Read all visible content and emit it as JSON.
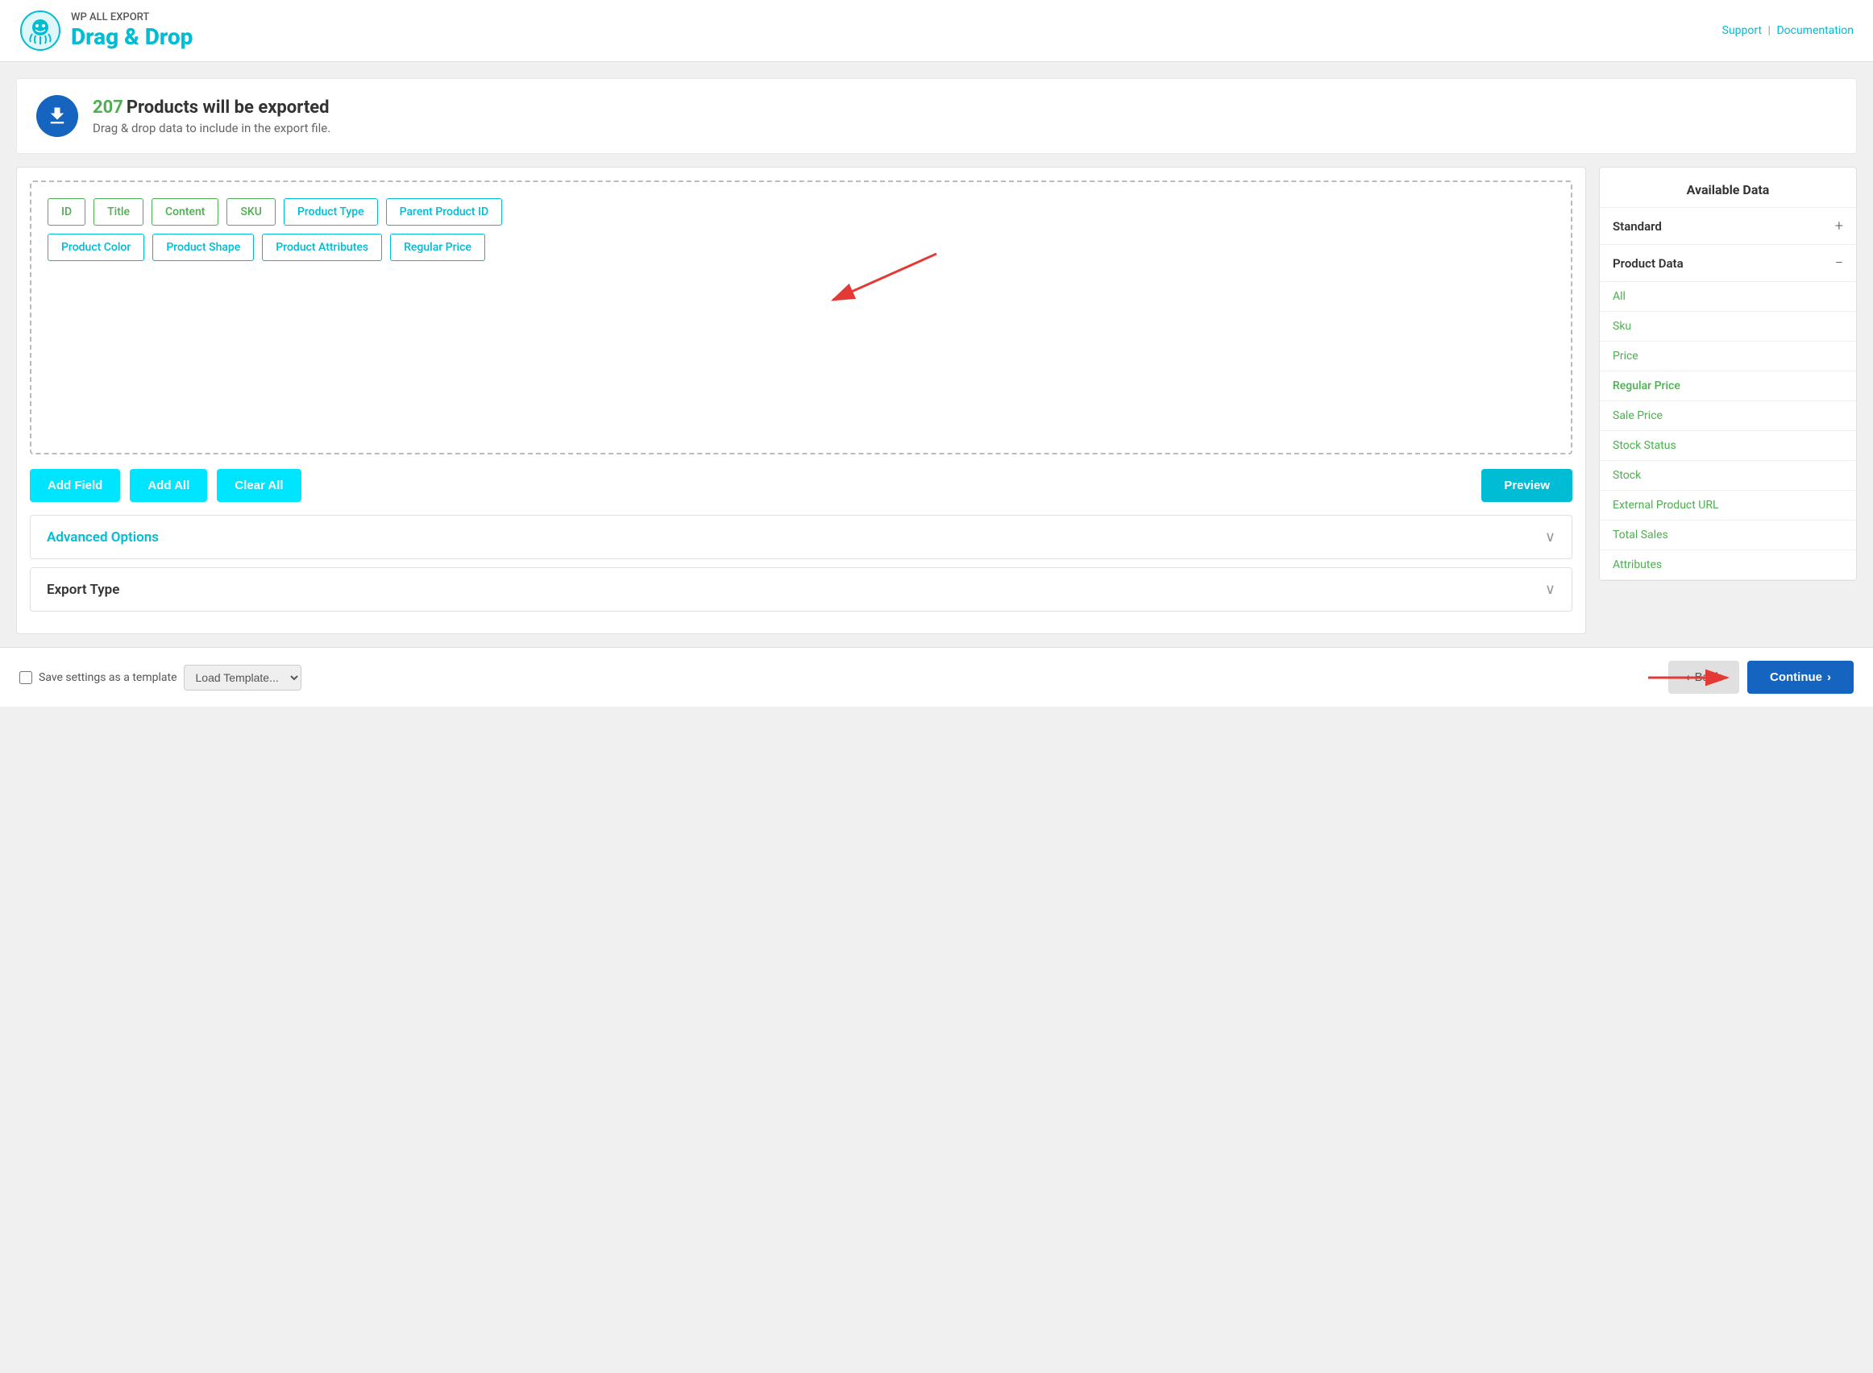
{
  "header": {
    "app_name": "WP ALL EXPORT",
    "app_title": "Drag & Drop",
    "support_label": "Support",
    "doc_label": "Documentation",
    "separator": "|"
  },
  "banner": {
    "count": "207",
    "title": "Products will be exported",
    "subtitle": "Drag & drop data to include in the export file."
  },
  "drop_zone": {
    "row1": [
      "ID",
      "Title",
      "Content",
      "SKU",
      "Product Type",
      "Parent Product ID"
    ],
    "row2": [
      "Product Color",
      "Product Shape",
      "Product Attributes",
      "Regular Price"
    ]
  },
  "buttons": {
    "add_field": "Add Field",
    "add_all": "Add All",
    "clear_all": "Clear All",
    "preview": "Preview",
    "advanced_options": "Advanced Options",
    "export_type": "Export Type",
    "back": "Back",
    "continue": "Continue"
  },
  "footer": {
    "save_label": "Save settings as a template",
    "load_placeholder": "Load Template..."
  },
  "right_panel": {
    "title": "Available Data",
    "sections": [
      {
        "label": "Standard",
        "toggle": "+",
        "items": []
      },
      {
        "label": "Product Data",
        "toggle": "-",
        "items": [
          "All",
          "Sku",
          "Price",
          "Regular Price",
          "Sale Price",
          "Stock Status",
          "Stock",
          "External Product URL",
          "Total Sales",
          "Attributes"
        ]
      }
    ]
  },
  "colors": {
    "cyan": "#00bcd4",
    "cyan_light": "#00e5ff",
    "green": "#4caf50",
    "blue_dark": "#1565c0",
    "red_arrow": "#e53935"
  }
}
